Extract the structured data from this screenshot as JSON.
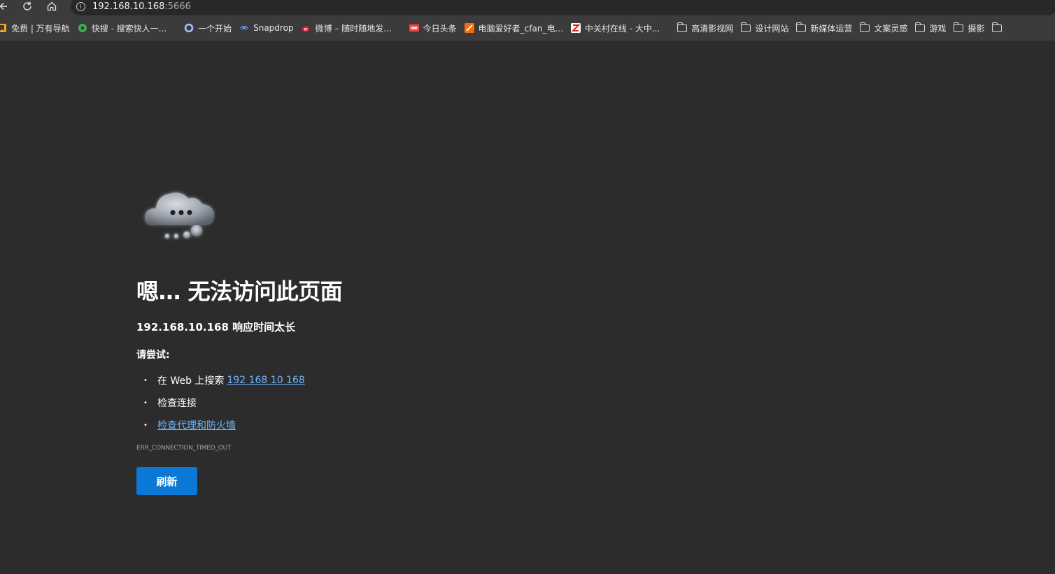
{
  "browser": {
    "address": {
      "host": "192.168.10.168",
      "port": ":5666"
    },
    "bookmarks": [
      {
        "label": "免费 | 万有导航",
        "icon": "bookmark-favicon",
        "color": "#f5a623"
      },
      {
        "label": "快搜 - 搜索快人一...",
        "icon": "quick-search-favicon",
        "color": "#3cb34a"
      },
      {
        "label": "一个开始",
        "icon": "ring-favicon",
        "color": "#8fb5ff"
      },
      {
        "label": "Snapdrop",
        "icon": "snapdrop-favicon",
        "color": "#5aa0ff"
      },
      {
        "label": "微博 – 随时随地发...",
        "icon": "weibo-favicon",
        "color": "#e6162d"
      },
      {
        "label": "今日头条",
        "icon": "toutiao-favicon",
        "color": "#f04142"
      },
      {
        "label": "电脑爱好者_cfan_电...",
        "icon": "cfan-favicon",
        "color": "#ff6a00"
      },
      {
        "label": "中关村在线 - 大中...",
        "icon": "zol-favicon",
        "color": "#2f6fd6"
      },
      {
        "label": "高清影视网",
        "icon": "folder-icon"
      },
      {
        "label": "设计网站",
        "icon": "folder-icon"
      },
      {
        "label": "新媒体运营",
        "icon": "folder-icon"
      },
      {
        "label": "文案灵感",
        "icon": "folder-icon"
      },
      {
        "label": "游戏",
        "icon": "folder-icon"
      },
      {
        "label": "摄影",
        "icon": "folder-icon"
      },
      {
        "label": "",
        "icon": "folder-icon"
      }
    ]
  },
  "error_page": {
    "title": "嗯… 无法访问此页面",
    "subtitle": "192.168.10.168 响应时间太长",
    "try_heading": "请尝试:",
    "suggestions": {
      "search_prefix": "在 Web 上搜索",
      "search_link": "192 168 10 168",
      "check_connection": "检查连接",
      "check_proxy": "检查代理和防火墙"
    },
    "error_code": "ERR_CONNECTION_TIMED_OUT",
    "refresh_button": "刷新"
  },
  "colors": {
    "background": "#2c2c2c",
    "link": "#6fb4ff",
    "button": "#0a78d4"
  }
}
